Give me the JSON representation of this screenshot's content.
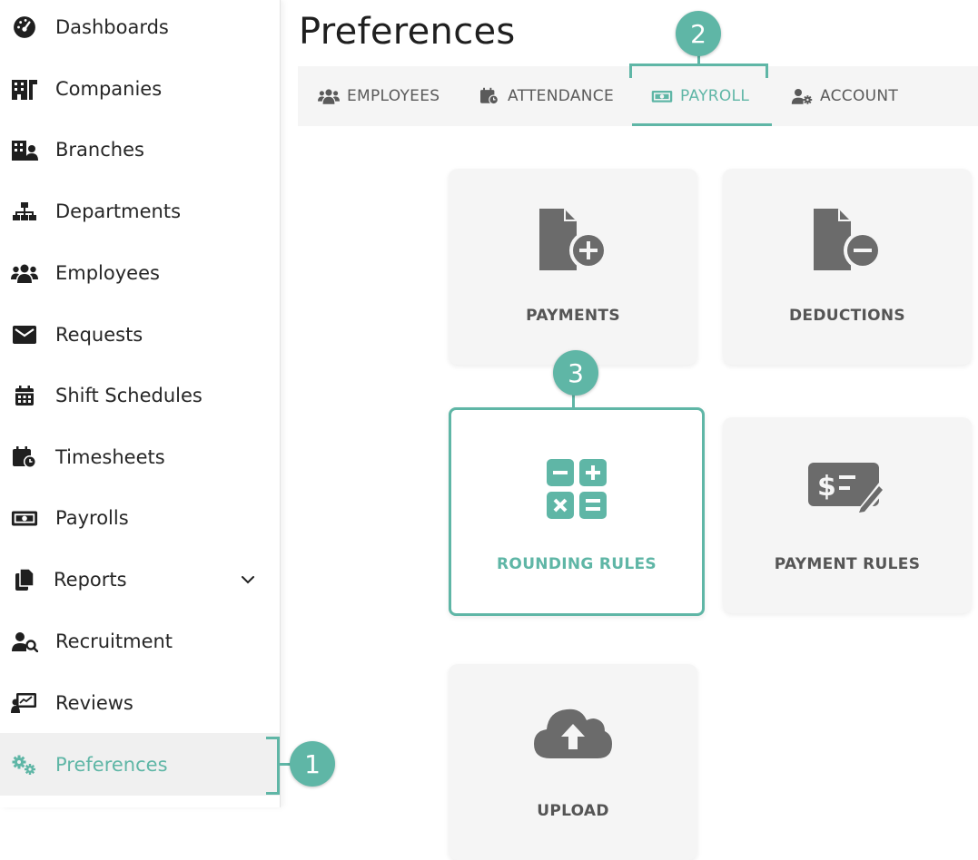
{
  "page": {
    "title": "Preferences"
  },
  "sidebar": {
    "items": [
      {
        "label": "Dashboards",
        "icon": "dashboard-gauge-icon"
      },
      {
        "label": "Companies",
        "icon": "building-icon"
      },
      {
        "label": "Branches",
        "icon": "branch-building-icon"
      },
      {
        "label": "Departments",
        "icon": "sitemap-icon"
      },
      {
        "label": "Employees",
        "icon": "users-icon"
      },
      {
        "label": "Requests",
        "icon": "envelope-icon"
      },
      {
        "label": "Shift Schedules",
        "icon": "calendar-icon"
      },
      {
        "label": "Timesheets",
        "icon": "calendar-clock-icon"
      },
      {
        "label": "Payrolls",
        "icon": "money-bill-icon"
      },
      {
        "label": "Reports",
        "icon": "copy-files-icon"
      },
      {
        "label": "Recruitment",
        "icon": "user-search-icon"
      },
      {
        "label": "Reviews",
        "icon": "chart-review-icon"
      },
      {
        "label": "Preferences",
        "icon": "cogs-icon"
      }
    ],
    "active": "Preferences"
  },
  "tabs": [
    {
      "label": "EMPLOYEES",
      "icon": "users-icon"
    },
    {
      "label": "ATTENDANCE",
      "icon": "calendar-clock-icon"
    },
    {
      "label": "PAYROLL",
      "icon": "money-bill-icon"
    },
    {
      "label": "ACCOUNT",
      "icon": "user-gear-icon"
    }
  ],
  "active_tab": "PAYROLL",
  "cards": [
    {
      "label": "PAYMENTS",
      "icon": "file-plus-icon"
    },
    {
      "label": "DEDUCTIONS",
      "icon": "file-minus-icon"
    },
    {
      "label": "ROUNDING RULES",
      "icon": "calculator-icon"
    },
    {
      "label": "PAYMENT RULES",
      "icon": "money-check-edit-icon"
    },
    {
      "label": "UPLOAD",
      "icon": "cloud-upload-icon"
    }
  ],
  "callouts": [
    "1",
    "2",
    "3"
  ],
  "colors": {
    "accent": "#5fb6a6",
    "icon_gray": "#6b6b6b",
    "sidebar_icon": "#1f1f1f",
    "card_bg": "#f5f5f5",
    "active_row_bg": "#f0f0f0"
  }
}
